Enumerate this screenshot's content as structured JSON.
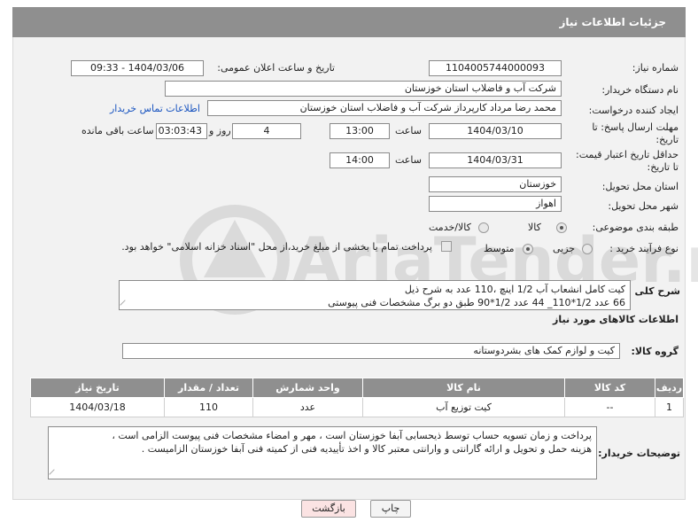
{
  "header": {
    "title": "جزئیات اطلاعات نیاز"
  },
  "fields": {
    "need_number_label": "شماره نیاز:",
    "need_number": "1104005744000093",
    "announce_label": "تاریخ و ساعت اعلان عمومی:",
    "announce_value": "1404/03/06 - 09:33",
    "buyer_org_label": "نام دستگاه خریدار:",
    "buyer_org": "شرکت آب و فاضلاب استان خوزستان",
    "requester_label": "ایجاد کننده درخواست:",
    "requester": "محمد رضا مرداد کارپرداز شرکت آب و فاضلاب استان خوزستان",
    "contact_link": "اطلاعات تماس خریدار",
    "deadline_label_1": "مهلت ارسال پاسخ: تا",
    "deadline_label_2": "تاریخ:",
    "deadline_date": "1404/03/10",
    "hour_label": "ساعت",
    "deadline_time": "13:00",
    "days_value": "4",
    "days_label": "روز و",
    "remaining_time": "03:03:43",
    "remaining_label": "ساعت باقی مانده",
    "price_label_1": "حداقل تاریخ اعتبار قیمت:",
    "price_label_2": "تا تاریخ:",
    "price_date": "1404/03/31",
    "price_time": "14:00",
    "province_label": "استان محل تحویل:",
    "province": "خوزستان",
    "city_label": "شهر محل تحویل:",
    "city": "اهواز",
    "category_label": "طبقه بندی موضوعی:",
    "category_goods": "کالا",
    "category_goods_service": "کالا/خدمت",
    "process_label": "نوع فرآیند خرید :",
    "process_partial": "جزیی",
    "process_medium": "متوسط",
    "payment_note": "پرداخت تمام یا بخشی از مبلغ خرید،از محل \"اسناد خزانه اسلامی\" خواهد بود."
  },
  "summary": {
    "label": "شرح کلی نیاز:",
    "line1": "کیت کامل انشعاب آب 1/2 اینچ ،110 عدد به شرح ذیل",
    "line2": "66 عدد 1/2*110_ 44 عدد 1/2*90 طبق دو برگ مشخصات فنی پیوستی"
  },
  "goods_info_title": "اطلاعات کالاهای مورد نیاز",
  "goods_group": {
    "label": "گروه کالا:",
    "value": "کیت و لوازم کمک های بشردوستانه"
  },
  "table": {
    "headers": [
      "ردیف",
      "کد کالا",
      "نام کالا",
      "واحد شمارش",
      "تعداد / مقدار",
      "تاریخ نیاز"
    ],
    "rows": [
      [
        "1",
        "--",
        "کیت توزیع آب",
        "عدد",
        "110",
        "1404/03/18"
      ]
    ]
  },
  "buyer_notes": {
    "label": "توضیحات خریدار:",
    "line1": "پرداخت و زمان تسویه حساب توسط ذیحسابی آبفا خوزستان است ، مهر و امضاء مشخصات فنی پیوست الزامی است ،",
    "line2": "هزینه حمل و تحویل و ارائه گارانتی و وارانتی معتبر کالا و اخذ تأییدیه فنی از کمیته فنی آبفا خوزستان الزامیست ."
  },
  "buttons": {
    "print": "چاپ",
    "back": "بازگشت"
  },
  "watermark_text": "AriaTender.neT"
}
